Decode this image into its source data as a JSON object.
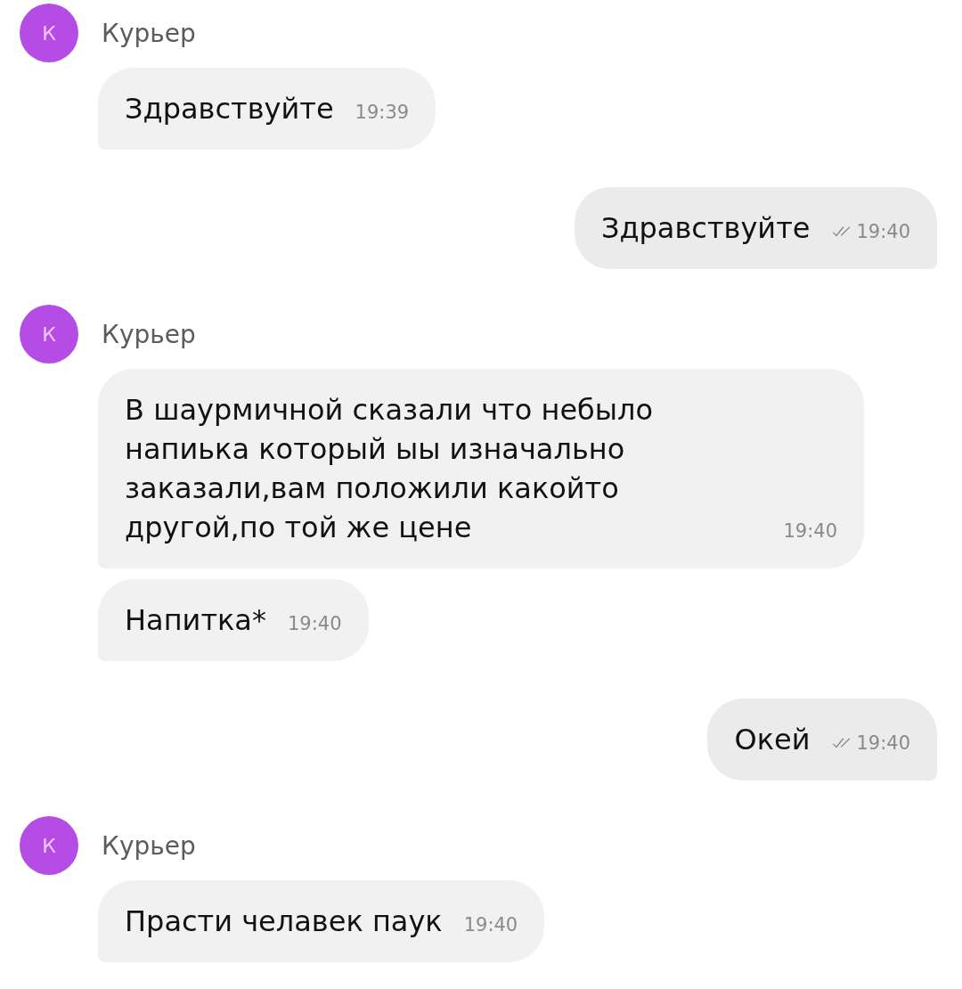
{
  "messages": [
    {
      "kind": "sender",
      "avatar": "К",
      "name": "Курьер"
    },
    {
      "kind": "incoming",
      "text": "Здравствуйте",
      "time": "19:39"
    },
    {
      "kind": "outgoing",
      "text": "Здравствуйте",
      "time": "19:40",
      "read": true
    },
    {
      "kind": "sender",
      "avatar": "К",
      "name": "Курьер"
    },
    {
      "kind": "incoming",
      "text": "В шаурмичной сказали что небыло напиька который ыы изначально заказали,вам положили какойто другой,по той же цене",
      "time": "19:40"
    },
    {
      "kind": "incoming",
      "text": "Напитка*",
      "time": "19:40"
    },
    {
      "kind": "outgoing",
      "text": "Окей",
      "time": "19:40",
      "read": true
    },
    {
      "kind": "sender",
      "avatar": "К",
      "name": "Курьер"
    },
    {
      "kind": "incoming",
      "text": "Прасти челавек паук",
      "time": "19:40"
    }
  ]
}
